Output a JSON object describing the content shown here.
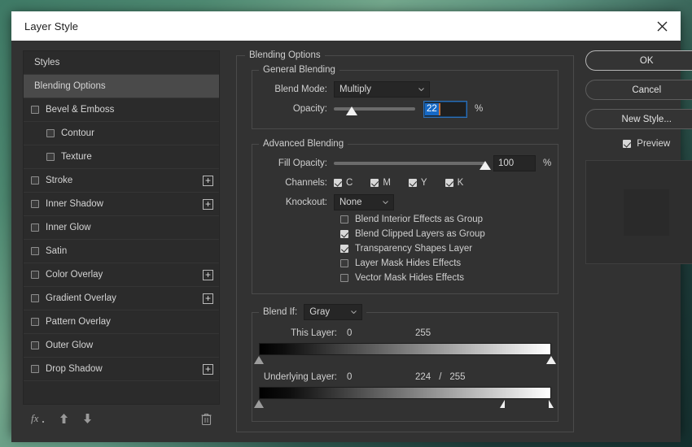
{
  "window": {
    "title": "Layer Style",
    "close_icon": "close-icon"
  },
  "sidebar": {
    "items": [
      {
        "label": "Styles",
        "type": "plain",
        "checked": false,
        "plus": false,
        "selected": false,
        "indent": false
      },
      {
        "label": "Blending Options",
        "type": "plain",
        "checked": false,
        "plus": false,
        "selected": true,
        "indent": false
      },
      {
        "label": "Bevel & Emboss",
        "type": "check",
        "checked": false,
        "plus": false,
        "selected": false,
        "indent": false
      },
      {
        "label": "Contour",
        "type": "check",
        "checked": false,
        "plus": false,
        "selected": false,
        "indent": true
      },
      {
        "label": "Texture",
        "type": "check",
        "checked": false,
        "plus": false,
        "selected": false,
        "indent": true
      },
      {
        "label": "Stroke",
        "type": "check",
        "checked": false,
        "plus": true,
        "selected": false,
        "indent": false
      },
      {
        "label": "Inner Shadow",
        "type": "check",
        "checked": false,
        "plus": true,
        "selected": false,
        "indent": false
      },
      {
        "label": "Inner Glow",
        "type": "check",
        "checked": false,
        "plus": false,
        "selected": false,
        "indent": false
      },
      {
        "label": "Satin",
        "type": "check",
        "checked": false,
        "plus": false,
        "selected": false,
        "indent": false
      },
      {
        "label": "Color Overlay",
        "type": "check",
        "checked": false,
        "plus": true,
        "selected": false,
        "indent": false
      },
      {
        "label": "Gradient Overlay",
        "type": "check",
        "checked": false,
        "plus": true,
        "selected": false,
        "indent": false
      },
      {
        "label": "Pattern Overlay",
        "type": "check",
        "checked": false,
        "plus": false,
        "selected": false,
        "indent": false
      },
      {
        "label": "Outer Glow",
        "type": "check",
        "checked": false,
        "plus": false,
        "selected": false,
        "indent": false
      },
      {
        "label": "Drop Shadow",
        "type": "check",
        "checked": false,
        "plus": true,
        "selected": false,
        "indent": false
      }
    ],
    "tools": [
      {
        "name": "fx-icon",
        "glyph": "fx"
      },
      {
        "name": "move-up-icon",
        "glyph": "up"
      },
      {
        "name": "move-down-icon",
        "glyph": "down"
      },
      {
        "name": "delete-icon",
        "glyph": "trash"
      }
    ]
  },
  "main": {
    "section_title": "Blending Options",
    "general": {
      "legend": "General Blending",
      "blend_mode_label": "Blend Mode:",
      "blend_mode_value": "Multiply",
      "opacity_label": "Opacity:",
      "opacity_value": "22",
      "opacity_percent": "%",
      "opacity_slider_pct": 22
    },
    "advanced": {
      "legend": "Advanced Blending",
      "fill_opacity_label": "Fill Opacity:",
      "fill_opacity_value": "100",
      "fill_opacity_percent": "%",
      "fill_opacity_slider_pct": 100,
      "channels_label": "Channels:",
      "channels": [
        {
          "label": "C",
          "checked": true
        },
        {
          "label": "M",
          "checked": true
        },
        {
          "label": "Y",
          "checked": true
        },
        {
          "label": "K",
          "checked": true
        }
      ],
      "knockout_label": "Knockout:",
      "knockout_value": "None",
      "options": [
        {
          "label": "Blend Interior Effects as Group",
          "checked": false
        },
        {
          "label": "Blend Clipped Layers as Group",
          "checked": true
        },
        {
          "label": "Transparency Shapes Layer",
          "checked": true
        },
        {
          "label": "Layer Mask Hides Effects",
          "checked": false
        },
        {
          "label": "Vector Mask Hides Effects",
          "checked": false
        }
      ]
    },
    "blend_if": {
      "label": "Blend If:",
      "channel_value": "Gray",
      "this_layer": {
        "label": "This Layer:",
        "black_value": "0",
        "white_value": "255",
        "black_pct": 0,
        "white_pct": 100
      },
      "underlying_layer": {
        "label": "Underlying Layer:",
        "black_value": "0",
        "white_value_low": "224",
        "separator": "/",
        "white_value_high": "255",
        "black_pct": 0,
        "white_low_pct": 84,
        "white_high_pct": 99
      }
    }
  },
  "actions": {
    "ok": "OK",
    "cancel": "Cancel",
    "new_style": "New Style...",
    "preview_label": "Preview",
    "preview_checked": true
  },
  "colors": {
    "dialog_bg": "#323232",
    "titlebar_bg": "#ffffff",
    "selection_blue": "#1669c6",
    "caret_orange": "#c4703a",
    "text": "#cfcfcf"
  }
}
